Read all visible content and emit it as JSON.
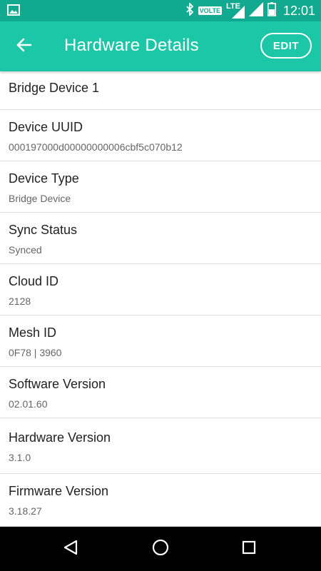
{
  "status_bar": {
    "time": "12:01",
    "volte": "VOLTE",
    "lte": "LTE",
    "icons": [
      "image-icon",
      "bluetooth-icon",
      "signal-icon",
      "battery-icon"
    ]
  },
  "app_bar": {
    "title": "Hardware Details",
    "edit_label": "EDIT",
    "color": "#1cc7a8"
  },
  "details": {
    "device_name": "Bridge Device 1",
    "items": [
      {
        "label": "Device UUID",
        "value": "000197000d00000000006cbf5c070b12"
      },
      {
        "label": "Device Type",
        "value": "Bridge Device"
      },
      {
        "label": "Sync Status",
        "value": "Synced"
      },
      {
        "label": "Cloud ID",
        "value": "2128"
      },
      {
        "label": "Mesh ID",
        "value": "0F78 | 3960"
      },
      {
        "label": "Software Version",
        "value": "02.01.60"
      },
      {
        "label": "Hardware Version",
        "value": "3.1.0"
      },
      {
        "label": "Firmware Version",
        "value": "3.18.27"
      }
    ]
  },
  "nav_bar": {
    "icons": [
      "back-triangle-icon",
      "home-circle-icon",
      "recents-square-icon"
    ]
  }
}
